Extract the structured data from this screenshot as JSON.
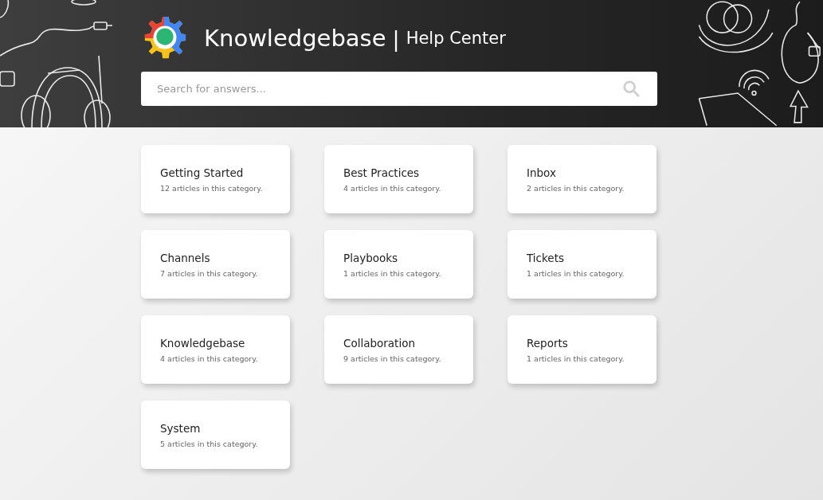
{
  "header": {
    "title": "Knowledgebase",
    "separator": "|",
    "subtitle": "Help Center"
  },
  "search": {
    "placeholder": "Search for answers..."
  },
  "categories": [
    {
      "name": "Getting Started",
      "count": "12 articles in this category."
    },
    {
      "name": "Best Practices",
      "count": "4 articles in this category."
    },
    {
      "name": "Inbox",
      "count": "2 articles in this category."
    },
    {
      "name": "Channels",
      "count": "7 articles in this category."
    },
    {
      "name": "Playbooks",
      "count": "1 articles in this category."
    },
    {
      "name": "Tickets",
      "count": "1 articles in this category."
    },
    {
      "name": "Knowledgebase",
      "count": "4 articles in this category."
    },
    {
      "name": "Collaboration",
      "count": "9 articles in this category."
    },
    {
      "name": "Reports",
      "count": "1 articles in this category."
    },
    {
      "name": "System",
      "count": "5 articles in this category."
    }
  ]
}
